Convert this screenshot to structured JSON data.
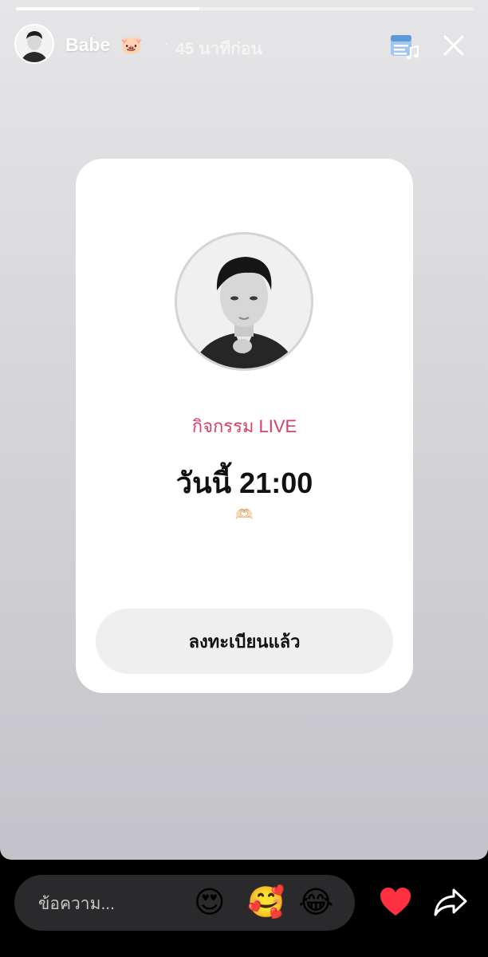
{
  "story": {
    "progress_percent": 40,
    "user": {
      "name": "Babe",
      "name_emoji": "🐷",
      "separator": "·",
      "time_ago": "45 นาทีก่อน"
    },
    "icons": {
      "music": "music-sticker-icon",
      "close": "close-icon"
    }
  },
  "card": {
    "label": "กิจกรรม LIVE",
    "time": "วันนี้ 21:00",
    "emoji": "🫶🏻",
    "button_label": "ลงทะเบียนแล้ว"
  },
  "bottom": {
    "message_placeholder": "ข้อความ...",
    "reactions": [
      "😍",
      "🥰",
      "😂"
    ],
    "icons": [
      "heart-icon",
      "share-icon"
    ]
  },
  "colors": {
    "accent_pink": "#d6416b",
    "heart_red": "#ff3040"
  }
}
